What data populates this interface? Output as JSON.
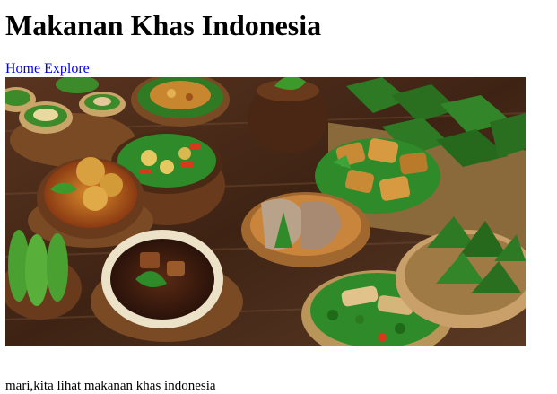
{
  "page": {
    "title": "Makanan Khas Indonesia"
  },
  "nav": {
    "links": [
      {
        "label": "Home"
      },
      {
        "label": "Explore"
      }
    ]
  },
  "hero_image": {
    "icon": "indonesian-food-spread-image"
  },
  "caption": {
    "text": "mari,kita lihat makanan khas indonesia"
  },
  "colors": {
    "link": "#0000ee",
    "text": "#000000",
    "table_wood": "#4a2a17",
    "leaf_green": "#2f8a2a"
  }
}
